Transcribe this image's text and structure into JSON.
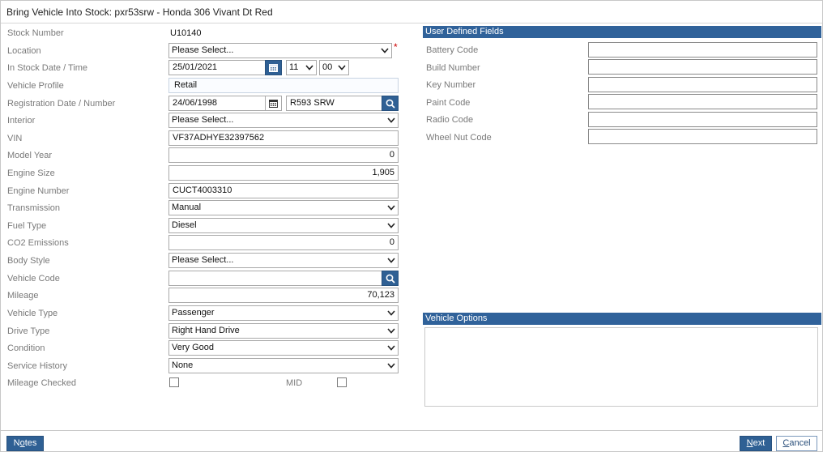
{
  "window": {
    "title": "Bring Vehicle Into Stock: pxr53srw - Honda 306 Vivant Dt Red"
  },
  "labels": {
    "stock_number": "Stock Number",
    "location": "Location",
    "in_stock": "In Stock Date / Time",
    "vehicle_profile": "Vehicle Profile",
    "registration": "Registration Date / Number",
    "interior": "Interior",
    "vin": "VIN",
    "model_year": "Model Year",
    "engine_size": "Engine Size",
    "engine_number": "Engine Number",
    "transmission": "Transmission",
    "fuel_type": "Fuel Type",
    "co2": "CO2 Emissions",
    "body_style": "Body Style",
    "vehicle_code": "Vehicle Code",
    "mileage": "Mileage",
    "vehicle_type": "Vehicle Type",
    "drive_type": "Drive Type",
    "condition": "Condition",
    "service_history": "Service History",
    "mileage_checked": "Mileage Checked",
    "mid": "MID"
  },
  "values": {
    "stock_number": "U10140",
    "location": "Please Select...",
    "in_stock_date": "25/01/2021",
    "in_stock_hour": "11",
    "in_stock_minute": "00",
    "vehicle_profile": "Retail",
    "registration_date": "24/06/1998",
    "registration_number": "R593 SRW",
    "interior": "Please Select...",
    "vin": "VF37ADHYE32397562",
    "model_year": "0",
    "engine_size": "1,905",
    "engine_number": "CUCT4003310",
    "transmission": "Manual",
    "fuel_type": "Diesel",
    "co2": "0",
    "body_style": "Please Select...",
    "vehicle_code": "",
    "mileage": "70,123",
    "vehicle_type": "Passenger",
    "drive_type": "Right Hand Drive",
    "condition": "Very Good",
    "service_history": "None",
    "mileage_checked": false,
    "mid": false
  },
  "required_marker": "*",
  "udf": {
    "header": "User Defined Fields",
    "fields": [
      {
        "label": "Battery Code",
        "value": ""
      },
      {
        "label": "Build Number",
        "value": ""
      },
      {
        "label": "Key Number",
        "value": ""
      },
      {
        "label": "Paint Code",
        "value": ""
      },
      {
        "label": "Radio Code",
        "value": ""
      },
      {
        "label": "Wheel Nut Code",
        "value": ""
      }
    ]
  },
  "vehicle_options": {
    "header": "Vehicle Options"
  },
  "footer": {
    "notes": {
      "pre": "N",
      "ul": "o",
      "post": "tes"
    },
    "next": {
      "pre": "",
      "ul": "N",
      "post": "ext"
    },
    "cancel": {
      "pre": "",
      "ul": "C",
      "post": "ancel"
    }
  },
  "colors": {
    "accent": "#30629a",
    "required": "#cc0000",
    "label": "#7a7a7a"
  },
  "icons": {
    "calendar": "calendar-icon",
    "search": "search-icon",
    "dropdown": "chevron-down-icon"
  }
}
